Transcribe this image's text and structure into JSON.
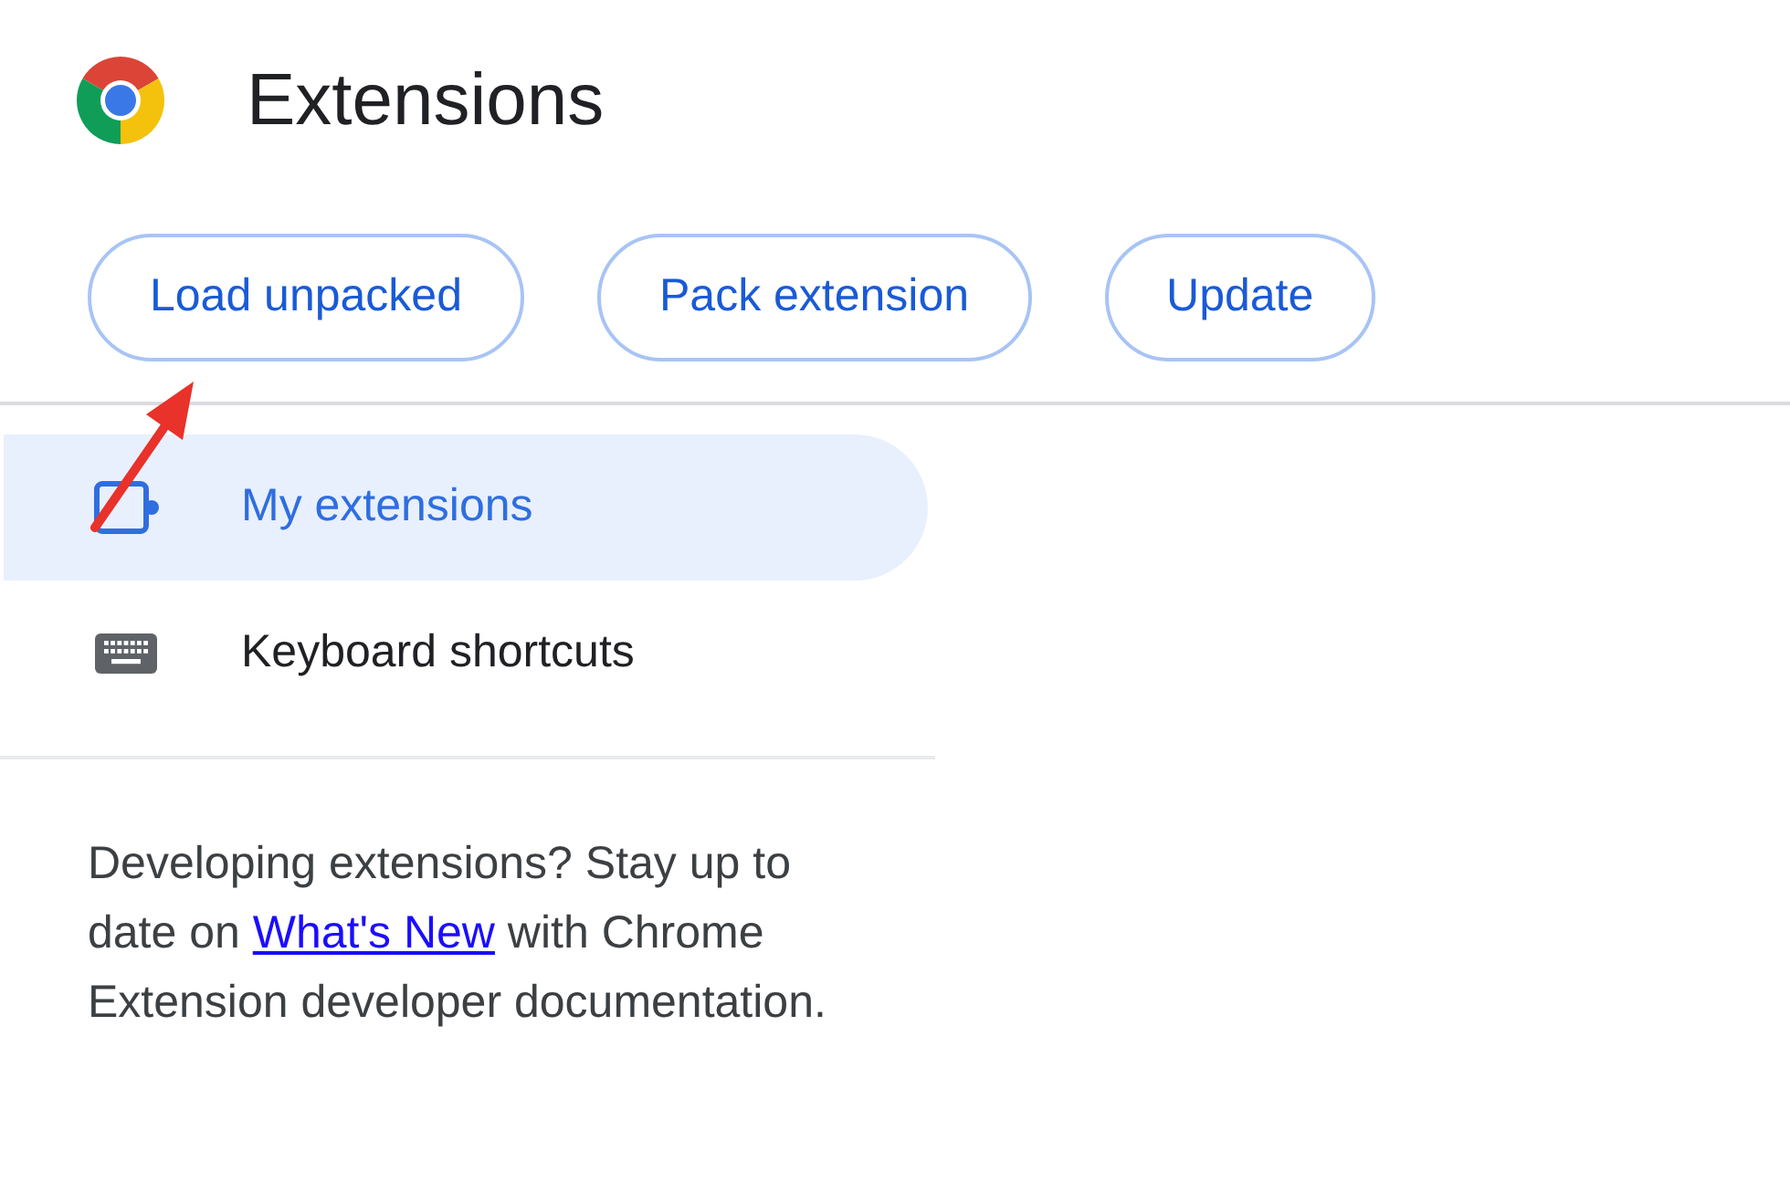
{
  "header": {
    "title": "Extensions"
  },
  "toolbar": {
    "buttons": [
      "Load unpacked",
      "Pack extension",
      "Update"
    ]
  },
  "sidebar": {
    "items": [
      {
        "kind": "puzzle",
        "label": "My extensions",
        "selected": true
      },
      {
        "kind": "keyboard",
        "label": "Keyboard shortcuts",
        "selected": false
      }
    ]
  },
  "footer_note": {
    "before": "Developing extensions? Stay up to date on",
    "link": "What's New",
    "after": "with Chrome Extension developer documentation."
  }
}
